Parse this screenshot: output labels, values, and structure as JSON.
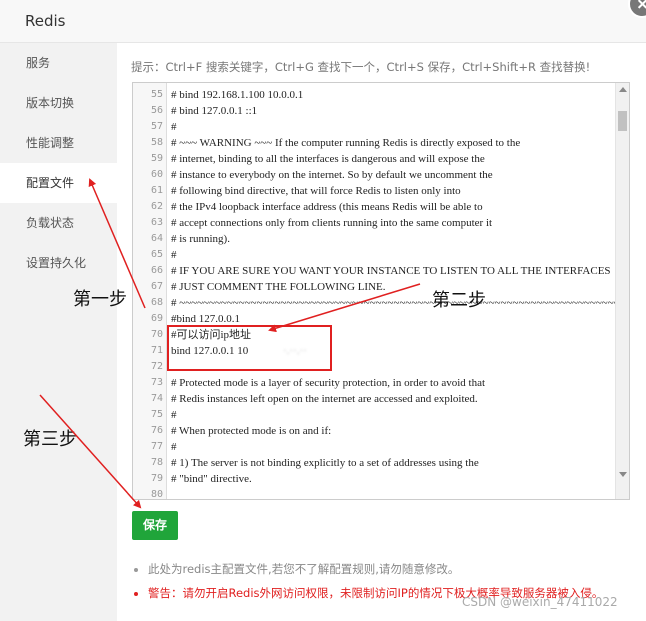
{
  "window": {
    "title": "Redis"
  },
  "sidebar": {
    "items": [
      {
        "label": "服务"
      },
      {
        "label": "版本切换"
      },
      {
        "label": "性能调整"
      },
      {
        "label": "配置文件"
      },
      {
        "label": "负载状态"
      },
      {
        "label": "设置持久化"
      }
    ],
    "active": "配置文件"
  },
  "hint": "提示：Ctrl+F 搜索关键字，Ctrl+G 查找下一个，Ctrl+S 保存，Ctrl+Shift+R 查找替换!",
  "editor": {
    "lines": [
      {
        "n": "55",
        "text": "# bind 192.168.1.100 10.0.0.1"
      },
      {
        "n": "56",
        "text": "# bind 127.0.0.1 ::1"
      },
      {
        "n": "57",
        "text": "#"
      },
      {
        "n": "58",
        "text": "# ~~~ WARNING ~~~ If the computer running Redis is directly exposed to the"
      },
      {
        "n": "59",
        "text": "# internet, binding to all the interfaces is dangerous and will expose the"
      },
      {
        "n": "60",
        "text": "# instance to everybody on the internet. So by default we uncomment the"
      },
      {
        "n": "61",
        "text": "# following bind directive, that will force Redis to listen only into"
      },
      {
        "n": "62",
        "text": "# the IPv4 loopback interface address (this means Redis will be able to"
      },
      {
        "n": "63",
        "text": "# accept connections only from clients running into the same computer it"
      },
      {
        "n": "64",
        "text": "# is running)."
      },
      {
        "n": "65",
        "text": "#"
      },
      {
        "n": "66",
        "text": "# IF YOU ARE SURE YOU WANT YOUR INSTANCE TO LISTEN TO ALL THE INTERFACES"
      },
      {
        "n": "67",
        "text": "# JUST COMMENT THE FOLLOWING LINE."
      },
      {
        "n": "68",
        "text": "# ~~~~~~~~~~~~~~~~~~~~~~~~~~~~~~~~~~~~~~~~~~~~~~~~~~~~~~~~~~~~~~~~~~~~~~~~~~~~~~~~"
      },
      {
        "n": "69",
        "text": "#bind 127.0.0.1"
      },
      {
        "n": "70",
        "text": "#可以访问ip地址"
      },
      {
        "n": "71",
        "text": "bind 127.0.0.1 10",
        "blurred": "·.··.··"
      },
      {
        "n": "72",
        "text": ""
      },
      {
        "n": "73",
        "text": "# Protected mode is a layer of security protection, in order to avoid that"
      },
      {
        "n": "74",
        "text": "# Redis instances left open on the internet are accessed and exploited."
      },
      {
        "n": "75",
        "text": "#"
      },
      {
        "n": "76",
        "text": "# When protected mode is on and if:"
      },
      {
        "n": "77",
        "text": "#"
      },
      {
        "n": "78",
        "text": "# 1) The server is not binding explicitly to a set of addresses using the"
      },
      {
        "n": "79",
        "text": "#    \"bind\" directive."
      },
      {
        "n": "80",
        "text": ""
      }
    ]
  },
  "save_label": "保存",
  "notes": [
    "此处为redis主配置文件,若您不了解配置规则,请勿随意修改。",
    "警告：请勿开启Redis外网访问权限，未限制访问IP的情况下极大概率导致服务器被入侵。"
  ],
  "annotations": {
    "step1": "第一步",
    "step2": "第二步",
    "step3": "第三步"
  },
  "watermark": "CSDN @weixin_47411022",
  "colors": {
    "accent_green": "#20a53a",
    "warning_red": "#e02020",
    "annotation_arrow": "#e02020"
  }
}
